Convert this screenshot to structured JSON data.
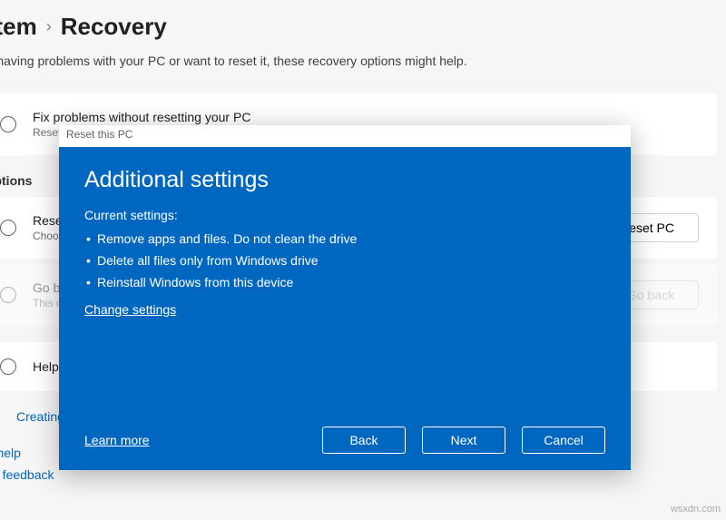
{
  "breadcrumb": {
    "parent": "stem",
    "sep": "›",
    "current": "Recovery"
  },
  "subtitle": "re having problems with your PC or want to reset it, these recovery options might help.",
  "card_fix": {
    "title": "Fix problems without resetting your PC",
    "desc": "Resetting"
  },
  "section_label": "ery options",
  "card_reset": {
    "title": "Reset th",
    "desc": "Choose to",
    "button": "Reset PC"
  },
  "card_goback": {
    "title": "Go back",
    "desc": "This optio",
    "button": "Go back"
  },
  "card_help": {
    "title": "Help wit"
  },
  "link_creating": "Creating",
  "link_gethelp": "Get help",
  "link_feedback": "Give feedback",
  "modal": {
    "titlebar": "Reset this PC",
    "heading": "Additional settings",
    "current_label": "Current settings:",
    "items": [
      "Remove apps and files. Do not clean the drive",
      "Delete all files only from Windows drive",
      "Reinstall Windows from this device"
    ],
    "change": "Change settings",
    "learn": "Learn more",
    "back": "Back",
    "next": "Next",
    "cancel": "Cancel"
  },
  "watermark": "wsxdn.com"
}
